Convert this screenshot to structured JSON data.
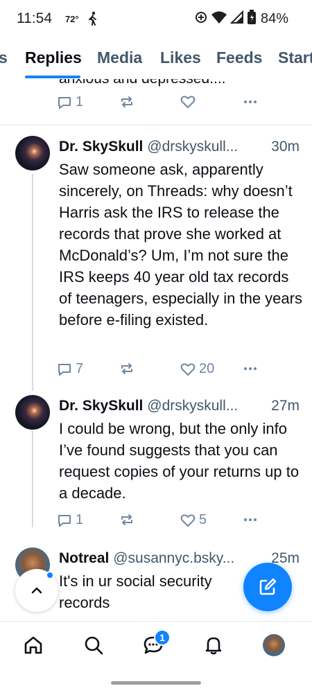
{
  "status_bar": {
    "time": "11:54",
    "temperature": "72°",
    "battery": "84%"
  },
  "tabs": [
    {
      "label": "s",
      "active": false
    },
    {
      "label": "Replies",
      "active": true
    },
    {
      "label": "Media",
      "active": false
    },
    {
      "label": "Likes",
      "active": false
    },
    {
      "label": "Feeds",
      "active": false
    },
    {
      "label": "Start",
      "active": false
    }
  ],
  "partial_post": {
    "cut_text": "anxious and depressed....",
    "reply_count": "1"
  },
  "posts": [
    {
      "display_name": "Dr. SkySkull",
      "handle": "@drskyskull...",
      "time": "30m",
      "body": "Saw someone ask, apparently sincerely, on Threads: why doesn’t Harris ask the IRS to release the records that prove she worked at McDonald’s? Um, I’m not sure the IRS keeps 40 year old tax records of teenagers, especially in the years before e-filing existed.",
      "replies": "7",
      "likes": "20"
    },
    {
      "display_name": "Dr. SkySkull",
      "handle": "@drskyskull...",
      "time": "27m",
      "body": "I could be wrong, but the only info I’ve found suggests that you can request copies of your returns up to a decade.",
      "replies": "1",
      "likes": "5"
    },
    {
      "display_name": "Notreal",
      "handle": "@susannyc.bsky...",
      "time": "25m",
      "body": "It's in ur social security records"
    }
  ],
  "bottom_nav": {
    "chat_badge": "1",
    "items": [
      "home-icon",
      "search-icon",
      "chat-icon",
      "bell-icon",
      "profile-avatar"
    ]
  },
  "colors": {
    "accent": "#1083fe",
    "muted_text": "#42576c",
    "action_icon": "#6f869f"
  }
}
